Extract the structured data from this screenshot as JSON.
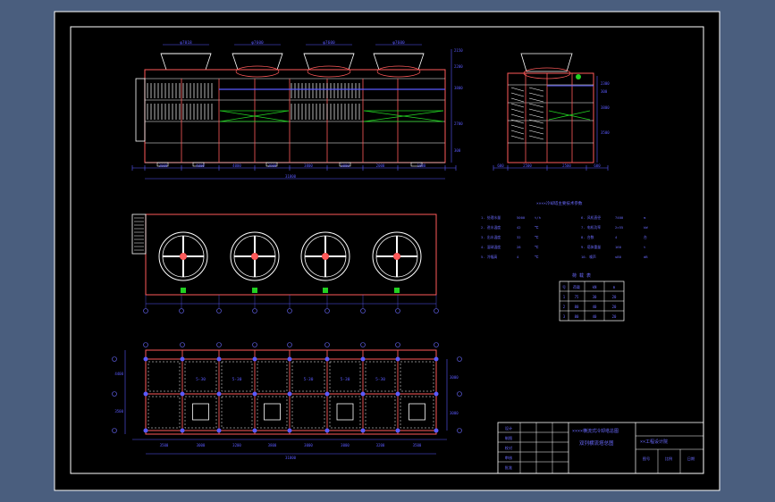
{
  "colors": {
    "background": "#4a5e7e",
    "sheet": "#000000",
    "frame": "#ffffff",
    "outline": "#ff5a5a",
    "structure": "#ffffff",
    "dimension": "#5a5aff",
    "text": "#e8e8ff",
    "accent_green": "#22d022",
    "axis_circle": "#6a6aff",
    "table_text": "#6a6aff"
  },
  "front_view": {
    "fan_labels": [
      "φ7018",
      "φ7600",
      "φ7600",
      "φ7600"
    ],
    "right_dims": [
      "2150",
      "2200",
      "3800",
      "2700",
      "300"
    ],
    "top_dims": [
      "3000",
      "4000",
      "4000",
      "3900",
      "3800",
      "3000",
      "2000",
      "1800"
    ],
    "total_dim": "31800"
  },
  "side_view": {
    "right_dims": [
      "2300",
      "300",
      "3800",
      "3500"
    ],
    "bottom_dims": [
      "600",
      "2500",
      "2500",
      "600"
    ]
  },
  "plan_view": {
    "fan_count": 4
  },
  "foundation_view": {
    "cell_labels": [
      "5-30",
      "5-30",
      "5-30",
      "5-30",
      "5-30",
      "5-30"
    ],
    "left_dims": [
      "4400",
      "3500"
    ],
    "right_dims": [
      "3000",
      "3000"
    ],
    "bottom_dims": [
      "3500",
      "3000",
      "3200",
      "3800",
      "3000",
      "3000",
      "3200",
      "3500"
    ],
    "total_dim": "31800"
  },
  "parameter_table": {
    "title": "××××冷却塔主要技术参数",
    "rows": [
      [
        "1. 处理水量",
        "5000",
        "t/h",
        "6. 风机直径",
        "7400",
        "m"
      ],
      [
        "2. 进水温度",
        "42",
        "℃",
        "7. 电机功率",
        "2×55",
        "kW"
      ],
      [
        "3. 出水温度",
        "32",
        "℃",
        "8. 台数",
        "4",
        "台"
      ],
      [
        "4. 湿球温度",
        "28",
        "℃",
        "9. 塔体重量",
        "160",
        "t"
      ],
      [
        "5. 冷幅高",
        "4",
        "℃",
        "10. 噪声",
        "≤80",
        "dB"
      ]
    ]
  },
  "load_table": {
    "title": "荷 载 表",
    "headers": [
      "号",
      "荷载",
      "kN",
      "m"
    ],
    "rows": [
      [
        "1",
        "75",
        "30",
        "20"
      ],
      [
        "2",
        "80",
        "40",
        "20"
      ],
      [
        "3",
        "80",
        "40",
        "20"
      ]
    ]
  },
  "title_block": {
    "drawing_title": "××××横流式冷却塔总图",
    "sub_title": "双列横流塔总图",
    "project": "××工程设计院",
    "left_labels": [
      "设计",
      "制图",
      "校对",
      "审核",
      "批准"
    ],
    "right_labels": [
      "图号",
      "比例",
      "日期"
    ]
  }
}
